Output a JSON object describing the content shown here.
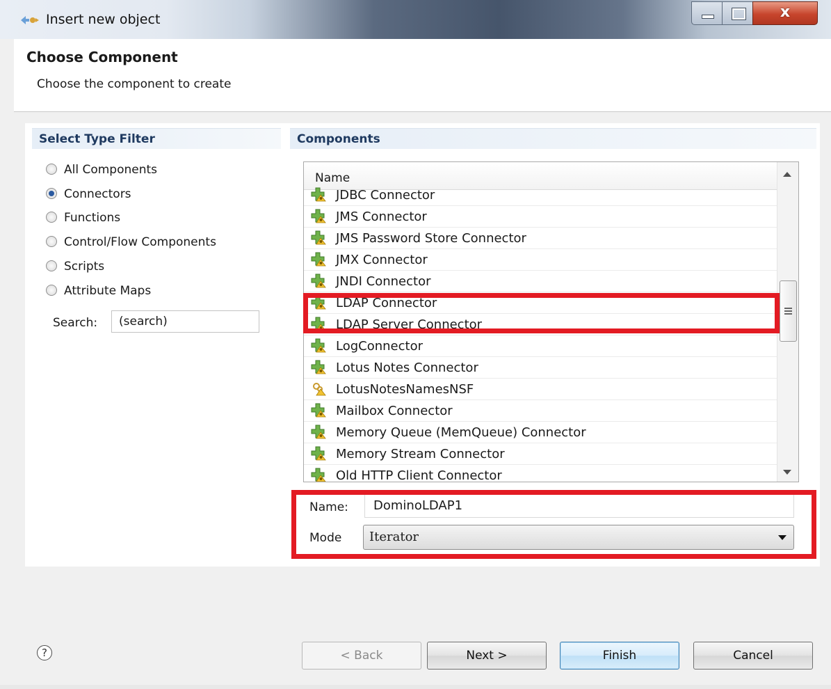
{
  "window": {
    "title": "Insert new object"
  },
  "header": {
    "title": "Choose Component",
    "description": "Choose the component to create"
  },
  "filter": {
    "heading": "Select Type Filter",
    "options": [
      {
        "label": "All Components",
        "checked": false
      },
      {
        "label": "Connectors",
        "checked": true
      },
      {
        "label": "Functions",
        "checked": false
      },
      {
        "label": "Control/Flow Components",
        "checked": false
      },
      {
        "label": "Scripts",
        "checked": false
      },
      {
        "label": "Attribute Maps",
        "checked": false
      }
    ],
    "search_label": "Search:",
    "search_value": "(search)"
  },
  "components": {
    "heading": "Components",
    "column_header": "Name",
    "items": [
      {
        "label": "JDBC Connector",
        "icon": "connector-icon"
      },
      {
        "label": "JMS Connector",
        "icon": "connector-icon"
      },
      {
        "label": "JMS Password Store Connector",
        "icon": "connector-icon"
      },
      {
        "label": "JMX Connector",
        "icon": "connector-icon"
      },
      {
        "label": "JNDI Connector",
        "icon": "connector-icon"
      },
      {
        "label": "LDAP Connector",
        "icon": "connector-icon",
        "highlighted": true
      },
      {
        "label": "LDAP Server Connector",
        "icon": "connector-icon"
      },
      {
        "label": "LogConnector",
        "icon": "connector-icon"
      },
      {
        "label": "Lotus Notes Connector",
        "icon": "connector-icon"
      },
      {
        "label": "LotusNotesNamesNSF",
        "icon": "script-connector-icon"
      },
      {
        "label": "Mailbox Connector",
        "icon": "connector-icon"
      },
      {
        "label": "Memory Queue (MemQueue) Connector",
        "icon": "connector-icon"
      },
      {
        "label": "Memory Stream Connector",
        "icon": "connector-icon"
      },
      {
        "label": "Old HTTP Client Connector",
        "icon": "connector-icon"
      }
    ]
  },
  "form": {
    "name_label": "Name:",
    "name_value": "DominoLDAP1",
    "mode_label": "Mode",
    "mode_value": "Iterator"
  },
  "buttons": {
    "back": "< Back",
    "next": "Next >",
    "finish": "Finish",
    "cancel": "Cancel",
    "help": "?"
  },
  "colors": {
    "highlight": "#e31b23",
    "section_heading": "#1f3a60",
    "default_button": "#3c7fb1"
  }
}
